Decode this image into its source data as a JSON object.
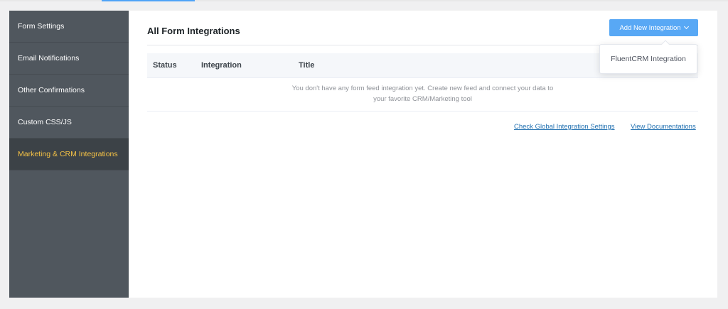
{
  "sidebar": {
    "items": [
      {
        "label": "Form Settings"
      },
      {
        "label": "Email Notifications"
      },
      {
        "label": "Other Confirmations"
      },
      {
        "label": "Custom CSS/JS"
      },
      {
        "label": "Marketing & CRM Integrations",
        "active": true
      }
    ]
  },
  "main": {
    "title": "All Form Integrations",
    "add_button_label": "Add New Integration",
    "table": {
      "columns": [
        "Status",
        "Integration",
        "Title"
      ],
      "empty_line1": "You don't have any form feed integration yet. Create new feed and connect your data to",
      "empty_line2": "your favorite CRM/Marketing tool"
    },
    "links": {
      "global_settings": "Check Global Integration Settings",
      "documentation": "View Documentations"
    }
  },
  "dropdown": {
    "items": [
      "FluentCRM Integration"
    ]
  },
  "colors": {
    "accent": "#58a8f5",
    "sidebar_bg": "#50575e",
    "sidebar_active_text": "#f5c245",
    "link": "#2271b1"
  },
  "icons": {
    "add_button": "chevron-down-icon"
  }
}
